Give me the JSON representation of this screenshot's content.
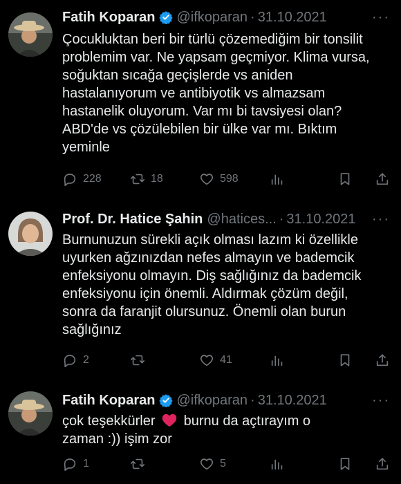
{
  "colors": {
    "background": "#000000",
    "text": "#e7e9ea",
    "muted": "#71767b",
    "verified": "#1d9bf0",
    "heart": "#e0245e"
  },
  "tweets": [
    {
      "name": "Fatih Koparan",
      "verified": true,
      "handle": "@ifkoparan",
      "separator": "·",
      "date": "31.10.2021",
      "text": "Çocukluktan beri bir türlü çözemediğim bir tonsilit\nproblemim var. Ne yapsam geçmiyor. Klima vursa,\nsoğuktan sıcağa geçişlerde vs aniden\nhastalanıyorum ve antibiyotik vs almazsam\nhastanelik oluyorum. Var mı bi tavsiyesi olan?\nABD'de vs çözülebilen bir ülke var mı. Bıktım\nyeminle",
      "replies": "228",
      "retweets": "18",
      "likes": "598"
    },
    {
      "name": "Prof. Dr. Hatice Şahin",
      "verified": false,
      "handle": "@hatices...",
      "separator": "·",
      "date": "31.10.2021",
      "text": "Burnunuzun sürekli açık olması lazım ki özellikle\nuyurken ağzınızdan nefes almayın ve bademcik\nenfeksiyonu olmayın. Diş sağlığınız da bademcik\nenfeksiyonu için önemli. Aldırmak çözüm değil,\nsonra da faranjit olursunuz. Önemli olan burun\nsağlığınız",
      "replies": "2",
      "retweets": "",
      "likes": "41"
    },
    {
      "name": "Fatih Koparan",
      "verified": true,
      "handle": "@ifkoparan",
      "separator": "·",
      "date": "31.10.2021",
      "text_before_emoji": "çok teşekkürler",
      "emoji": "red-heart-emoji",
      "text_after_emoji": "burnu da açtırayım o\nzaman :)) işim zor",
      "replies": "1",
      "retweets": "",
      "likes": "5"
    }
  ]
}
